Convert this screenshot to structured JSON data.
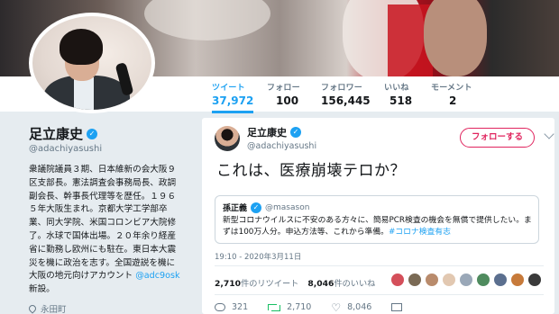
{
  "profile": {
    "name": "足立康史",
    "handle": "@adachiyasushi",
    "bio_lines": [
      "衆議院議員３期、日本維新の会大阪９",
      "区支部長。憲法調査会事務局長、政調",
      "副会長、幹事長代理等を歴任。１９６",
      "５年大阪生まれ。京都大学工学部卒",
      "業、同大学院、米国コロンビア大院修",
      "了。水球で国体出場。２０年余り経産",
      "省に勤務し欧州にも駐在。東日本大震",
      "災を機に政治を志す。全国遊説を機に",
      "大阪の地元向けアカウント"
    ],
    "bio_mention": "@adc9osk",
    "bio_tail": "新設。",
    "location": "永田町"
  },
  "nav": {
    "stats": [
      {
        "label": "ツイート",
        "value": "37,972"
      },
      {
        "label": "フォロー",
        "value": "100"
      },
      {
        "label": "フォロワー",
        "value": "156,445"
      },
      {
        "label": "いいね",
        "value": "518"
      },
      {
        "label": "モーメント",
        "value": "2"
      }
    ]
  },
  "tweet": {
    "author_name": "足立康史",
    "author_handle": "@adachiyasushi",
    "follow_label": "フォローする",
    "text": "これは、医療崩壊テロか？",
    "quote": {
      "name": "孫正義",
      "handle": "@masason",
      "text": "新型コロナウイルスに不安のある方々に、簡易PCR検査の機会を無償で提供したい。まずは100万人分。申込方法等、これから準備。",
      "hashtag": "#コロナ検査有志"
    },
    "timestamp": "19:10 - 2020年3月11日",
    "retweet_count": "2,710",
    "retweet_label": "件のリツイート",
    "like_count": "8,046",
    "like_label": "件のいいね",
    "actions": {
      "reply": "321",
      "retweet": "2,710",
      "like": "8,046"
    }
  },
  "colors": {
    "accent": "#1da1f2",
    "follow": "#e0245e",
    "retweet": "#17bf63",
    "background": "#e6ecf0"
  }
}
